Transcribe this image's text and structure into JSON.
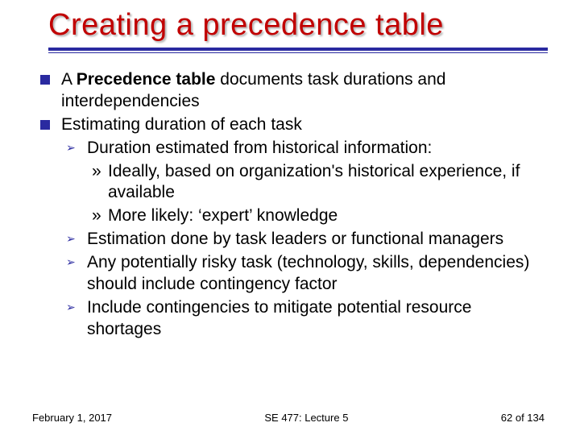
{
  "title": "Creating a precedence table",
  "bullets": {
    "item1": {
      "prefix": "A ",
      "bold": "Precedence table",
      "suffix": " documents task durations and interdependencies"
    },
    "item2": {
      "text": "Estimating duration of each task",
      "sub1": {
        "text": "Duration estimated from historical information:",
        "a": "Ideally, based on organization's historical experience, if available",
        "b": "More likely: ‘expert’ knowledge"
      },
      "sub2": "Estimation done by task leaders or functional managers",
      "sub3": "Any potentially risky task (technology, skills, dependencies) should include contingency factor",
      "sub4": "Include contingencies to mitigate potential resource shortages"
    }
  },
  "footer": {
    "left": "February 1, 2017",
    "center": "SE 477: Lecture 5",
    "right": "62 of 134"
  },
  "glyphs": {
    "arrow": "➢",
    "raquo": "»"
  }
}
